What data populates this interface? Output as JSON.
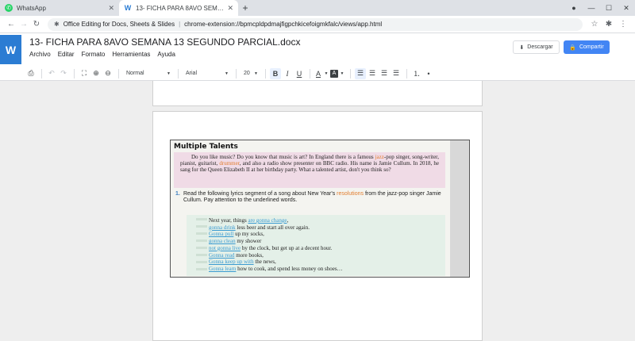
{
  "browser": {
    "tabs": [
      {
        "title": "WhatsApp",
        "active": false,
        "icon": "whatsapp-icon"
      },
      {
        "title": "13- FICHA PARA 8AVO SEMANA 13 SEGUNDO PARCIAL.docx",
        "active": true,
        "icon": "word-icon"
      }
    ],
    "url_extension_name": "Office Editing for Docs, Sheets & Slides",
    "url": "chrome-extension://bpmcpldpdmajfigpchkicefoigmkfalc/views/app.html"
  },
  "app": {
    "logo": "W",
    "doc_title": "13- FICHA PARA 8AVO SEMANA 13 SEGUNDO PARCIAL.docx",
    "menus": [
      "Archivo",
      "Editar",
      "Formato",
      "Herramientas",
      "Ayuda"
    ],
    "download_label": "Descargar",
    "share_label": "Compartir",
    "accent": "#4285f4",
    "brand": "#2b7cd3"
  },
  "toolbar": {
    "style": "Normal",
    "font": "Arial",
    "size": "20",
    "bold": "B",
    "italic": "I",
    "underline": "U",
    "text_color": "A",
    "highlight": "A"
  },
  "document": {
    "heading": "Multiple Talents",
    "intro": {
      "before_jazz": "Do you like music? Do you know that music is art? In England there is a famous ",
      "jazz": "jazz",
      "before_drummer": "-pop singer, song-writer, pianist, guitarist, ",
      "drummer": "drummer",
      "rest": ", and also a radio show presenter on BBC radio. His name is Jamie Cullum. In 2018, he sang for the Queen Elizabeth II at her birthday party. What a talented artist, don't you think so?"
    },
    "question": {
      "number": "1.",
      "before": "Read the following lyrics segment of a song about New Year's ",
      "highlight": "resolutions",
      "after": " from the jazz-pop singer Jamie Cullum. Pay attention to the underlined words."
    },
    "lyrics": [
      {
        "a": "Next year, things ",
        "u": "are gonna change",
        "b": ","
      },
      {
        "a": "",
        "u": "gonna drink",
        "b": " less beer and start all over again."
      },
      {
        "a": "",
        "u": "Gonna pull",
        "b": " up my socks,"
      },
      {
        "a": "",
        "u": "gonna clean",
        "b": " my shower"
      },
      {
        "a": "",
        "u": "not gonna live",
        "b": " by the clock, but get up at a decent hour."
      },
      {
        "a": "",
        "u": "Gonna read",
        "b": " more books,"
      },
      {
        "a": "",
        "u": "Gonna keep up with",
        "b": " the news,"
      },
      {
        "a": "",
        "u": "Gonna learn",
        "b": " how to cook, and spend less money on shoes…"
      }
    ]
  }
}
